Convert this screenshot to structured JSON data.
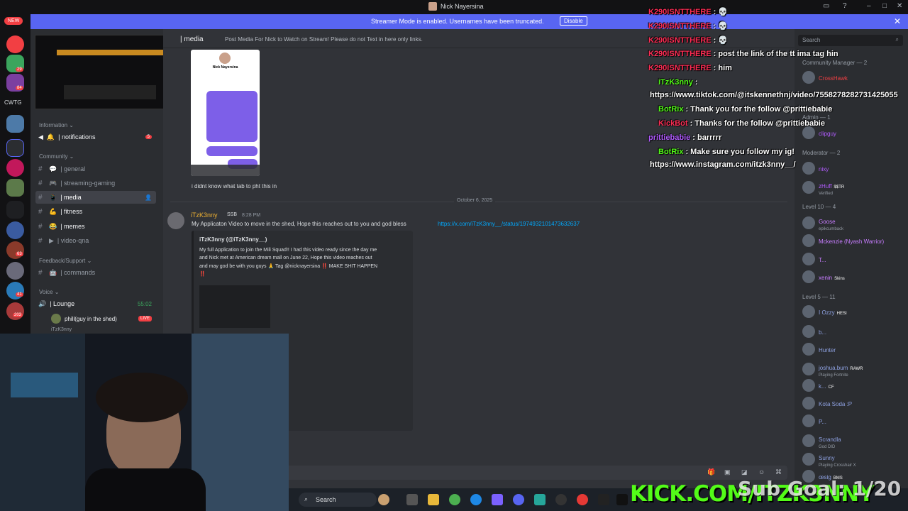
{
  "window": {
    "title": "Nick Nayersina"
  },
  "banner": {
    "message": "Streamer Mode is enabled. Usernames have been truncated.",
    "disable_label": "Disable"
  },
  "serverbar": {
    "new_label": "NEW",
    "cwtg_label": "CWTG",
    "badges": [
      "29",
      "84",
      "63",
      "41",
      "203"
    ]
  },
  "channels": {
    "cat_information": "Information ⌄",
    "notifications": "| notifications",
    "notifications_badge": "5",
    "cat_community": "Community ⌄",
    "general": "| general",
    "streaming_gaming": "| streaming-gaming",
    "media": "| media",
    "fitness": "| fitness",
    "memes": "| memes",
    "video_qna": "| video-qna",
    "cat_feedback": "Feedback/Support ⌄",
    "commands": "| commands",
    "cat_voice": "Voice ⌄",
    "lounge": "| Lounge",
    "lounge_time": "55:02",
    "voice_user1": "phill(guy in the shed)",
    "live_label": "LIVE",
    "voice_user2": "iTzK3nny"
  },
  "chat": {
    "channel_name": "| media",
    "topic": "Post Media For Nick to Watch on Stream! Please do not Text in here only links.",
    "phone_name": "Nick Nayersina",
    "msg1": "i didnt know what tab to pht this in",
    "date_divider": "October 6, 2025",
    "author": "iTzK3nny",
    "author_tag": "SSB",
    "timestamp": "8:28 PM",
    "body": "My Applicaton Video to move in the shed, Hope this reaches out to you and god bless",
    "link": "https://x.com/iTzK3nny__/status/1974932101473632637",
    "embed_author": "iTzK3nny (@iTzK3nny__)",
    "embed_text_1": "My full Application to join the Mili Squad!! I had this video ready since the day me",
    "embed_text_2": "and Nick met at American dream mall on June 22, Hope this video reaches out",
    "embed_text_3": "and may god be with you guys 🙏 Tag @nicknayersina ‼️ MAKE SHIT HAPPEN",
    "embed_text_4": "‼️"
  },
  "stream_chat": [
    {
      "user": "K290ISNTTHERE",
      "text": ": 💀",
      "color": "#ff2d55"
    },
    {
      "user": "K290ISNTTHERE",
      "text": ": 💀",
      "color": "#ff2d55"
    },
    {
      "user": "K290ISNTTHERE",
      "text": ": 💀",
      "color": "#ff2d55"
    },
    {
      "user": "K290ISNTTHERE",
      "text": ": post the link of the tt ima tag hin",
      "color": "#ff2d55"
    },
    {
      "user": "K290ISNTTHERE",
      "text": ": him",
      "color": "#ff2d55"
    },
    {
      "user": "iTzK3nny",
      "text": ":",
      "color": "#53fc18"
    },
    {
      "user": "",
      "text": "https://www.tiktok.com/@itskennethnj/video/7558278282731425055",
      "color": "#ffffff"
    },
    {
      "user": "BotRix",
      "text": ": Thank you for the follow @prittiebabie",
      "color": "#53fc18"
    },
    {
      "user": "KickBot",
      "text": ": Thanks for the follow @prittiebabie",
      "color": "#ff2d55"
    },
    {
      "user": "prittiebabie",
      "text": ": barrrrr",
      "color": "#b25cff"
    },
    {
      "user": "BotRix",
      "text": ": Make sure you follow my ig!",
      "color": "#53fc18"
    },
    {
      "user": "",
      "text": "https://www.instagram.com/itzk3nny__/",
      "color": "#ffffff"
    }
  ],
  "members": {
    "search_placeholder": "Search",
    "community_manager": "Community Manager — 2",
    "admin": "Admin — 1",
    "moderator": "Moderator — 2",
    "level10": "Level 10 — 4",
    "level5": "Level 5 — 11",
    "list": [
      {
        "name": "CrossHawk",
        "color": "#f23f43",
        "sub": ""
      },
      {
        "name": "clipguy",
        "color": "#b25cff",
        "sub": ""
      },
      {
        "name": "nixy",
        "color": "#b25cff",
        "sub": ""
      },
      {
        "name": "zHuff",
        "color": "#b25cff",
        "sub": "Verified",
        "tag": "$$TR"
      },
      {
        "name": "Goose",
        "color": "#c77dff",
        "sub": "epikcumback"
      },
      {
        "name": "Mckenzie (Nyash Warrior)",
        "color": "#c77dff",
        "sub": ""
      },
      {
        "name": "T...",
        "color": "#c77dff",
        "sub": ""
      },
      {
        "name": "xenin",
        "color": "#c77dff",
        "sub": "",
        "tag": "Skins"
      },
      {
        "name": "I Ozzy",
        "color": "#8ea1e1",
        "sub": "",
        "tag": "HESI"
      },
      {
        "name": "b...",
        "color": "#8ea1e1",
        "sub": ""
      },
      {
        "name": "Hunter",
        "color": "#8ea1e1",
        "sub": ""
      },
      {
        "name": "joshua.bum",
        "color": "#8ea1e1",
        "sub": "Playing Fortnite",
        "tag": "RAWR"
      },
      {
        "name": "k...",
        "color": "#8ea1e1",
        "sub": "",
        "tag": "CF"
      },
      {
        "name": "Kota Soda :P",
        "color": "#8ea1e1",
        "sub": ""
      },
      {
        "name": "P...",
        "color": "#8ea1e1",
        "sub": ""
      },
      {
        "name": "Scrandla",
        "color": "#8ea1e1",
        "sub": "God DID"
      },
      {
        "name": "Sunny",
        "color": "#8ea1e1",
        "sub": "Playing Crosshair X"
      },
      {
        "name": "œsig",
        "color": "#8ea1e1",
        "sub": "",
        "tag": "BMS"
      }
    ]
  },
  "taskbar": {
    "search_label": "Search"
  },
  "overlay": {
    "kick_text": "KICK.COM/ITZK3NNY",
    "subgoal_text": "Sub Goal: 1/20"
  }
}
